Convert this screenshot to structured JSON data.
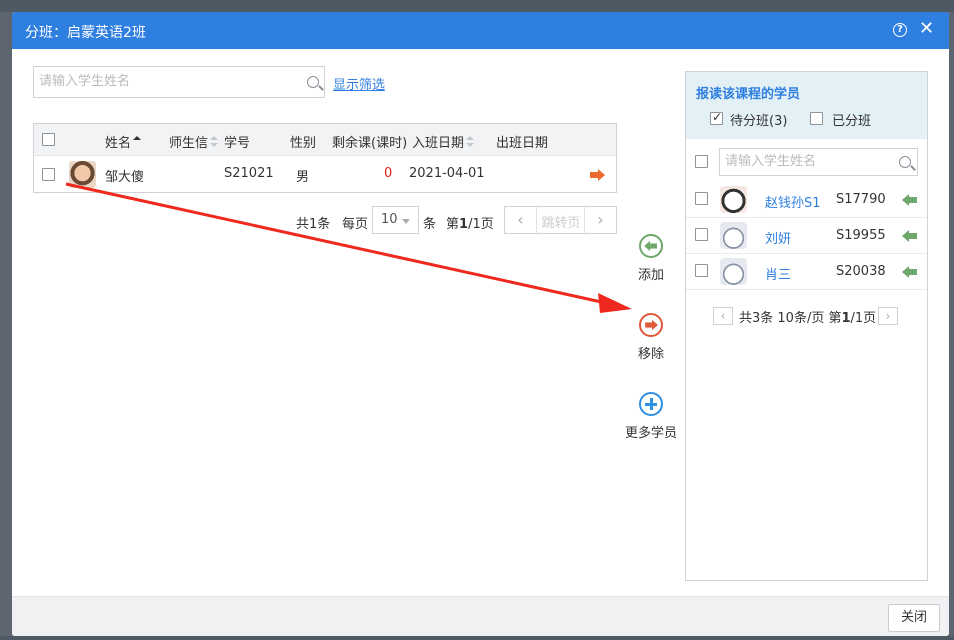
{
  "dialog": {
    "title": "分班：启蒙英语2班",
    "close_button": "关闭",
    "help_icon": "?",
    "close_icon": "✕"
  },
  "left": {
    "search_placeholder": "请输入学生姓名",
    "filter_link": "显示筛选",
    "columns": [
      "姓名",
      "师生信",
      "学号",
      "性别",
      "剩余课(课时)",
      "入班日期",
      "出班日期"
    ],
    "rows": [
      {
        "name": "邹大傻",
        "student_no": "S21021",
        "gender": "男",
        "remaining": "0",
        "join_date": "2021-04-01",
        "leave_date": ""
      }
    ],
    "pager": {
      "total_prefix": "共",
      "total": "1",
      "total_suffix": "条",
      "per_page_label": "每页",
      "per_page_value": "10",
      "per_page_unit": "条",
      "page_prefix": "第",
      "page_current": "1",
      "page_total": "/1页",
      "jump_placeholder": "跳转页",
      "prev_icon": "‹",
      "next_icon": "›"
    }
  },
  "actions": {
    "add": "添加",
    "remove": "移除",
    "more": "更多学员"
  },
  "right": {
    "title": "报读该课程的学员",
    "option_pending": "待分班(3)",
    "option_assigned": "已分班",
    "search_placeholder": "请输入学生姓名",
    "rows": [
      {
        "name": "赵钱孙S1",
        "student_no": "S17790"
      },
      {
        "name": "刘妍",
        "student_no": "S19955"
      },
      {
        "name": "肖三",
        "student_no": "S20038"
      }
    ],
    "pager": {
      "prev_icon": "‹",
      "text_prefix": "共3条 10条/页 第",
      "page_current": "1",
      "text_suffix": "/1页",
      "next_icon": "›"
    }
  },
  "colors": {
    "titlebar": "#2f7fe0",
    "accent_red": "#e02020",
    "annotation_arrow": "#f0291e",
    "add_green": "#6fa86a",
    "remove_orange": "#e0583a",
    "more_blue": "#2f8fe0"
  }
}
